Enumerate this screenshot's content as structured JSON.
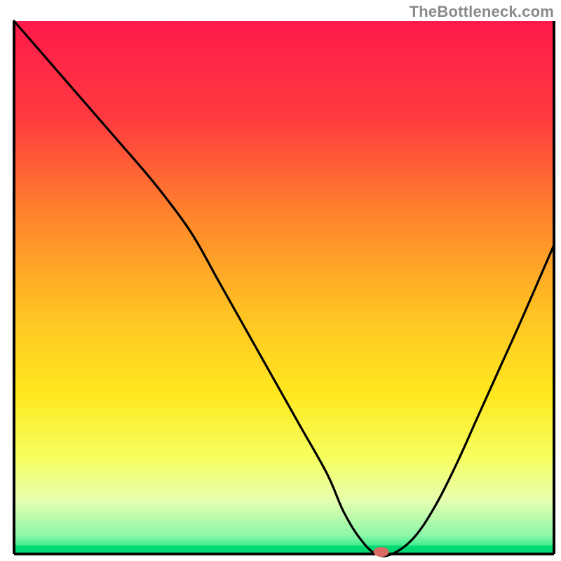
{
  "watermark": "TheBottleneck.com",
  "chart_data": {
    "type": "line",
    "title": "",
    "xlabel": "",
    "ylabel": "",
    "xlim": [
      0,
      100
    ],
    "ylim": [
      0,
      100
    ],
    "grid": false,
    "legend": false,
    "background_gradient": {
      "stops": [
        {
          "offset": 0.0,
          "color": "#ff1a4b"
        },
        {
          "offset": 0.18,
          "color": "#ff3a3f"
        },
        {
          "offset": 0.38,
          "color": "#ff8a2a"
        },
        {
          "offset": 0.55,
          "color": "#ffc323"
        },
        {
          "offset": 0.7,
          "color": "#ffe81f"
        },
        {
          "offset": 0.82,
          "color": "#f6ff60"
        },
        {
          "offset": 0.9,
          "color": "#e6ffb0"
        },
        {
          "offset": 0.965,
          "color": "#8cf7a8"
        },
        {
          "offset": 1.0,
          "color": "#00e67a"
        }
      ]
    },
    "series": [
      {
        "name": "bottleneck-curve",
        "x": [
          0,
          6,
          12,
          18,
          24,
          28,
          33,
          38,
          43,
          48,
          53,
          58,
          61,
          64,
          67,
          70,
          74,
          78,
          82,
          86,
          90,
          94,
          100
        ],
        "values": [
          100,
          93,
          86,
          79,
          72,
          67,
          60,
          51,
          42,
          33,
          24,
          15,
          8,
          3,
          0,
          0,
          3,
          9,
          17,
          26,
          35,
          44,
          58
        ]
      }
    ],
    "marker": {
      "name": "optimal-point",
      "x": 68,
      "y": 0,
      "color": "#d96b63",
      "rx": 11,
      "ry": 7
    }
  }
}
